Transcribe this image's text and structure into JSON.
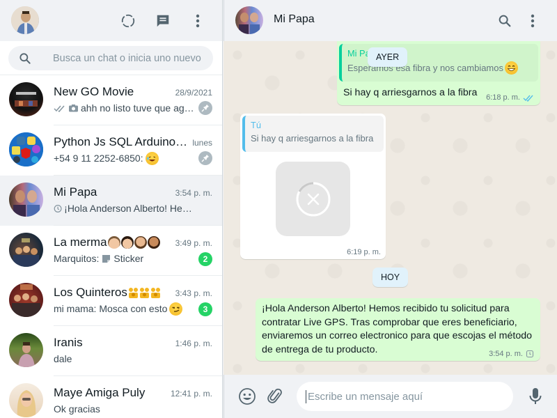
{
  "left_header": {
    "icons": [
      "status-icon",
      "new-chat-icon",
      "menu-icon"
    ]
  },
  "search": {
    "placeholder": "Busca un chat o inicia uno nuevo"
  },
  "chats": [
    {
      "name": "New GO Movie",
      "time": "28/9/2021",
      "preview": "ahh no listo tuve que ag…",
      "ticks": "double-check",
      "has_photo_icon": true,
      "pinned": true,
      "unread": "",
      "avatar_colors": [
        "#111",
        "#5a2a1a"
      ]
    },
    {
      "name": "Python Js SQL Arduino…",
      "time": "lunes",
      "preview": "+54 9 11 2252-6850:",
      "pinned": true,
      "unread": "",
      "avatar_colors": [
        "#0a6fc4",
        "#f5c400"
      ]
    },
    {
      "name": "Mi Papa",
      "time": "3:54 p. m.",
      "preview": "¡Hola Anderson Alberto! Hemo…",
      "pending_clock": true,
      "pinned": false,
      "unread": "",
      "active": true,
      "avatar_colors": [
        "#5a4a3a",
        "#6a8ad0"
      ]
    },
    {
      "name": "La merma",
      "time": "3:49 p. m.",
      "preview": "Marquitos:",
      "sticker_label": "Sticker",
      "pinned": false,
      "unread": "2",
      "avatar_colors": [
        "#1b2a3a",
        "#c08040"
      ]
    },
    {
      "name": "Los Quinteros",
      "time": "3:43 p. m.",
      "preview": "mi mama: Mosca con esto",
      "pinned": false,
      "unread": "3",
      "avatar_colors": [
        "#8a2a2a",
        "#d0a070"
      ]
    },
    {
      "name": "Iranis",
      "time": "1:46 p. m.",
      "preview": "dale",
      "pinned": false,
      "unread": "",
      "avatar_colors": [
        "#3a5a2a",
        "#c89aa0"
      ]
    },
    {
      "name": "Maye Amiga Puly",
      "time": "12:41 p. m.",
      "preview": "Ok gracias",
      "pinned": false,
      "unread": "",
      "avatar_colors": [
        "#e0c0a0",
        "#f5e0c0"
      ]
    }
  ],
  "conversation": {
    "contact_name": "Mi Papa",
    "messages": {
      "m1": {
        "quote_author": "Mi Papa",
        "quote_text": "Esperamos esa fibra y nos cambiamos",
        "text": "Si hay q arriesgarnos a la fibra",
        "time": "6:18 p. m."
      },
      "day1": "AYER",
      "m2": {
        "quote_author": "Tú",
        "quote_text": "Si hay q arriesgarnos a la fibra",
        "time": "6:19 p. m."
      },
      "day2": "HOY",
      "m3": {
        "text": "¡Hola Anderson Alberto! Hemos recibido tu solicitud para contratar Live GPS. Tras comprobar que eres beneficiario, enviaremos un correo electronico para que escojas el método de entrega de tu producto.",
        "time": "3:54 p. m."
      }
    }
  },
  "composer": {
    "placeholder": "Escribe un mensaje aquí",
    "icons": [
      "emoji-icon",
      "attach-icon",
      "microphone-icon"
    ]
  },
  "colors": {
    "accent_green": "#25d366",
    "outgoing_bubble": "#d9fdd3",
    "read_ticks": "#53bdeb",
    "quote_green": "#06cf9c",
    "quote_blue": "#53bdeb"
  }
}
